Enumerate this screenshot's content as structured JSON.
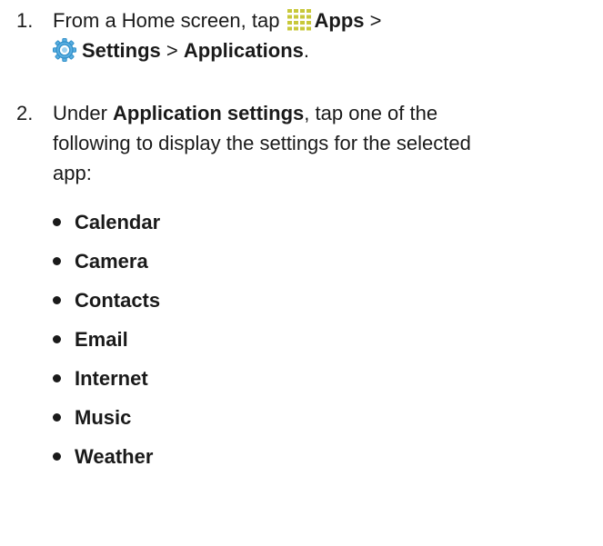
{
  "steps": [
    {
      "number": "1.",
      "line1": {
        "text_a": "From a Home screen, tap ",
        "bold_a": "Apps",
        "text_b": " >"
      },
      "line2": {
        "bold_a": "Settings",
        "text_a": " > ",
        "bold_b": "Applications",
        "text_b": "."
      },
      "icons": [
        "apps-grid-icon",
        "settings-gear-icon"
      ]
    },
    {
      "number": "2.",
      "line1": {
        "text_a": "Under ",
        "bold_a": "Application settings",
        "text_b": ", tap one of the"
      },
      "line2": "following to display the settings for the selected",
      "line3": "app:"
    }
  ],
  "apps": [
    "Calendar",
    "Camera",
    "Contacts",
    "Email",
    "Internet",
    "Music",
    "Weather"
  ],
  "colors": {
    "text": "#1a1a1a",
    "apps_icon": "#c8c83a",
    "settings_icon": "#2f8fc9"
  }
}
